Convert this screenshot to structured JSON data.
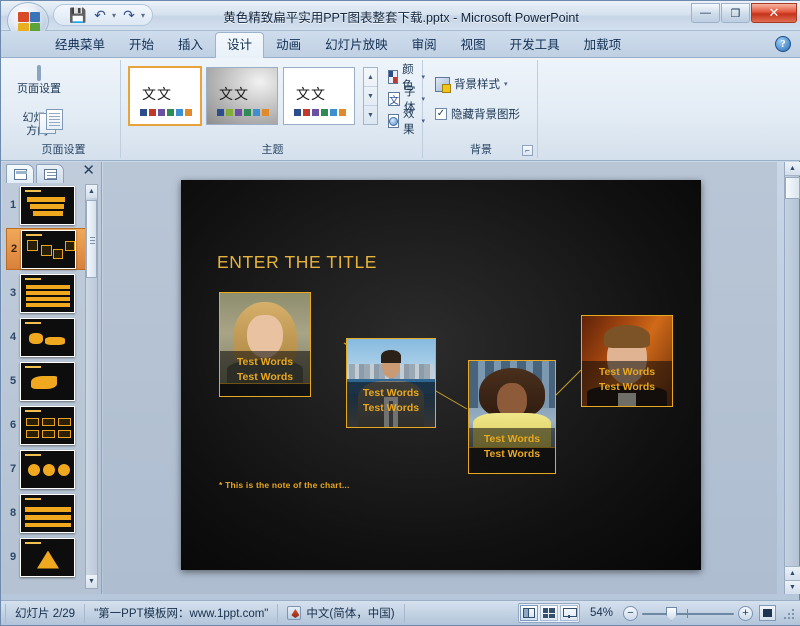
{
  "window": {
    "title": "黄色精致扁平实用PPT图表整套下载.pptx - Microsoft PowerPoint",
    "minimize_label": "—",
    "restore_label": "❐",
    "close_label": "✕"
  },
  "quick_access": {
    "save_label": "💾",
    "undo_label": "↶",
    "undo_caret": "▾",
    "redo_label": "↷",
    "customize_label": "▾"
  },
  "tabs": [
    {
      "label": "经典菜单",
      "active": false
    },
    {
      "label": "开始",
      "active": false
    },
    {
      "label": "插入",
      "active": false
    },
    {
      "label": "设计",
      "active": true
    },
    {
      "label": "动画",
      "active": false
    },
    {
      "label": "幻灯片放映",
      "active": false
    },
    {
      "label": "审阅",
      "active": false
    },
    {
      "label": "视图",
      "active": false
    },
    {
      "label": "开发工具",
      "active": false
    },
    {
      "label": "加载项",
      "active": false
    }
  ],
  "help_button_label": "?",
  "ribbon": {
    "groups": [
      {
        "name": "页面设置"
      },
      {
        "name": "主题"
      },
      {
        "name": "背景"
      }
    ],
    "page_setup": {
      "page_setup_label": "页面设置",
      "orientation_label": "幻灯片\n方向",
      "orientation_line1": "幻灯片",
      "orientation_line2": "方向",
      "orientation_caret": "▾"
    },
    "theme": {
      "thumb_text": "文文",
      "scroll_up": "▲",
      "scroll_down": "▼",
      "scroll_more": "▼",
      "colors_label": "颜色",
      "fonts_label": "字体",
      "fonts_glyph": "文",
      "effects_label": "效果",
      "caret": "▾"
    },
    "background": {
      "styles_label": "背景样式",
      "styles_caret": "▾",
      "hide_graphics_label": "隐藏背景图形",
      "hide_graphics_checked": "✓",
      "dialog_launcher": "⌐"
    }
  },
  "slide_panel": {
    "tab_slides_name": "slides-tab",
    "tab_outline_name": "outline-tab",
    "close_label": "✕",
    "scroll_up": "▲",
    "scroll_down": "▼",
    "slides": [
      {
        "number": "1",
        "active": false
      },
      {
        "number": "2",
        "active": true
      },
      {
        "number": "3",
        "active": false
      },
      {
        "number": "4",
        "active": false
      },
      {
        "number": "5",
        "active": false
      },
      {
        "number": "6",
        "active": false
      },
      {
        "number": "7",
        "active": false
      },
      {
        "number": "8",
        "active": false
      },
      {
        "number": "9",
        "active": false
      }
    ]
  },
  "slide": {
    "title": "ENTER THE TITLE",
    "note": "* This is the note of the chart...",
    "nodes": [
      {
        "caption_line1": "Test Words",
        "caption_line2": "Test Words"
      },
      {
        "caption_line1": "Test Words",
        "caption_line2": "Test Words"
      },
      {
        "caption_line1": "Test Words",
        "caption_line2": "Test Words"
      },
      {
        "caption_line1": "Test Words",
        "caption_line2": "Test Words"
      }
    ]
  },
  "workspace_scroll": {
    "up": "▲",
    "down": "▼",
    "prev_slide": "▲",
    "next_slide": "▼",
    "split": "▬"
  },
  "status_bar": {
    "slide_indicator": "幻灯片 2/29",
    "template_name": "\"第一PPT模板网：www.1ppt.com\"",
    "language": "中文(简体，中国)",
    "zoom_percent": "54%",
    "zoom_out_label": "−",
    "zoom_in_label": "+",
    "view_normal_name": "normal-view-button",
    "view_sorter_name": "slide-sorter-button",
    "view_reading_name": "reading-view-button",
    "fit_label": "fit-slide-to-window"
  },
  "colors": {
    "accent_gold": "#e8a81f",
    "title_gold": "#e6b43c",
    "slide_bg": "#111111",
    "selected_slide": "#e09340",
    "window_chrome": "#c3d2e4"
  }
}
